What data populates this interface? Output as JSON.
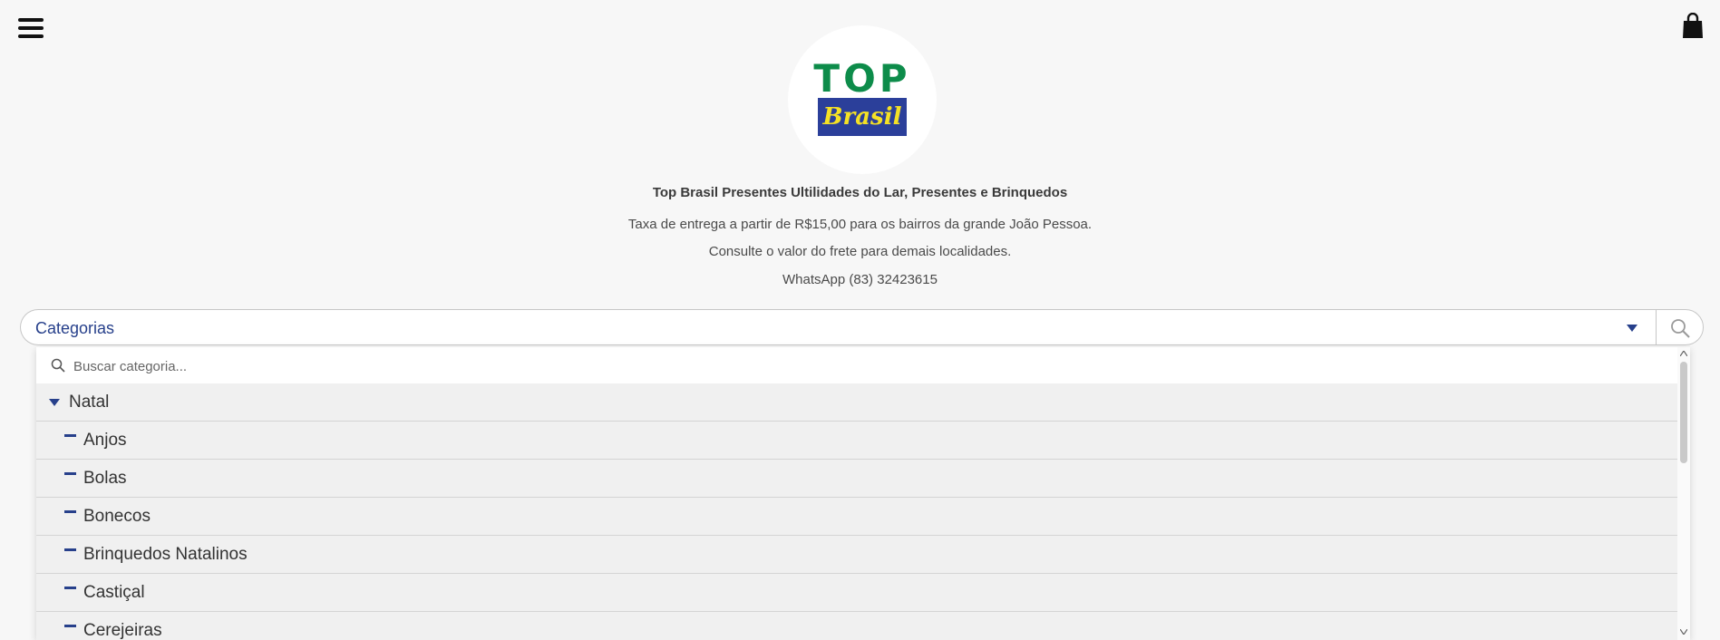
{
  "header": {
    "menu_icon": "hamburger-menu-icon",
    "cart_icon": "shopping-bag-icon"
  },
  "logo": {
    "line1": "TOP",
    "line2": "Brasil",
    "colors": {
      "top": "#0d8c4a",
      "box": "#2b3f9a",
      "brasil": "#f5e125"
    }
  },
  "store": {
    "title": "Top Brasil Presentes Ultilidades do Lar, Presentes e Brinquedos",
    "delivery": "Taxa de entrega a partir de R$15,00 para os bairros da grande João Pessoa.",
    "freight": "Consulte o valor do frete para demais localidades.",
    "whatsapp": "WhatsApp (83) 32423615"
  },
  "category_select": {
    "label": "Categorias",
    "caret_icon": "caret-down-icon",
    "search_icon": "search-icon",
    "accent": "#27408b"
  },
  "dropdown": {
    "search_placeholder": "Buscar categoria...",
    "items": [
      {
        "label": "Natal",
        "type": "parent"
      },
      {
        "label": "Anjos",
        "type": "child"
      },
      {
        "label": "Bolas",
        "type": "child"
      },
      {
        "label": "Bonecos",
        "type": "child"
      },
      {
        "label": "Brinquedos Natalinos",
        "type": "child"
      },
      {
        "label": "Castiçal",
        "type": "child"
      },
      {
        "label": "Cerejeiras",
        "type": "child"
      }
    ]
  }
}
